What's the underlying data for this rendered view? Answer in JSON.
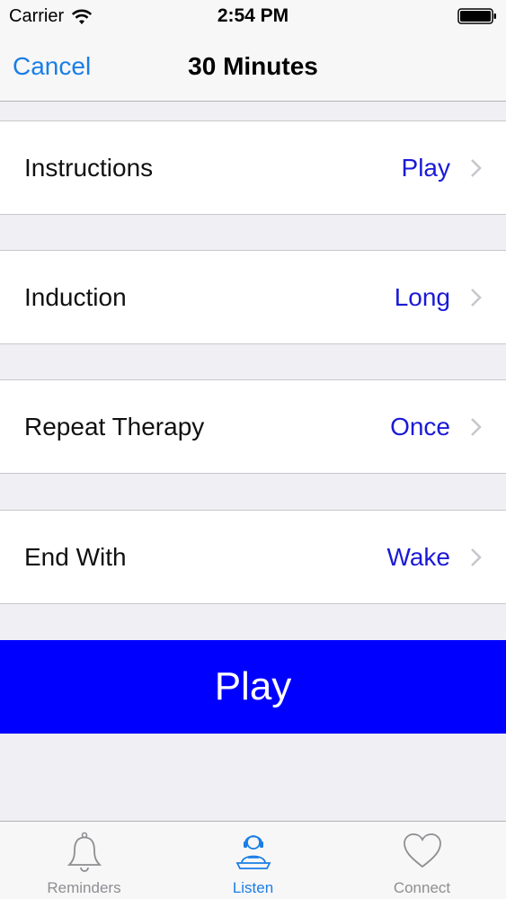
{
  "status_bar": {
    "carrier": "Carrier",
    "time": "2:54 PM"
  },
  "nav": {
    "cancel_label": "Cancel",
    "title": "30 Minutes"
  },
  "rows": [
    {
      "label": "Instructions",
      "value": "Play"
    },
    {
      "label": "Induction",
      "value": "Long"
    },
    {
      "label": "Repeat Therapy",
      "value": "Once"
    },
    {
      "label": "End With",
      "value": "Wake"
    }
  ],
  "play_button": {
    "label": "Play"
  },
  "tabs": [
    {
      "label": "Reminders",
      "icon": "bell-icon",
      "active": false
    },
    {
      "label": "Listen",
      "icon": "listener-headset-icon",
      "active": true
    },
    {
      "label": "Connect",
      "icon": "heart-icon",
      "active": false
    }
  ],
  "colors": {
    "accent": "#1a7ee6",
    "value_text": "#1a1ad6",
    "play_button": "#0000ff",
    "background": "#efeff4",
    "inactive_tab": "#8e8e93"
  }
}
